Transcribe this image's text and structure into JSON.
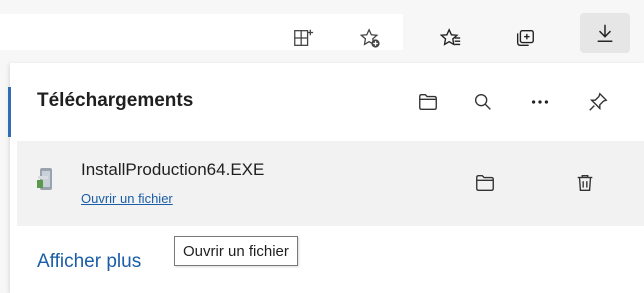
{
  "toolbar": {
    "icons": [
      "split-screen-icon",
      "add-favorite-icon",
      "favorites-icon",
      "collections-icon",
      "downloads-icon"
    ]
  },
  "downloads_panel": {
    "title": "Téléchargements",
    "header_icons": [
      "open-folder-icon",
      "search-icon",
      "more-options-icon",
      "pin-icon"
    ],
    "item": {
      "file_name": "InstallProduction64.EXE",
      "action_link": "Ouvrir un fichier",
      "icons": [
        "show-in-folder-icon",
        "delete-icon"
      ]
    },
    "show_more": "Afficher plus",
    "tooltip": "Ouvrir un fichier"
  },
  "colors": {
    "link": "#1a5ea8",
    "accent": "#2f6db5",
    "row_background": "#f2f2f2"
  }
}
